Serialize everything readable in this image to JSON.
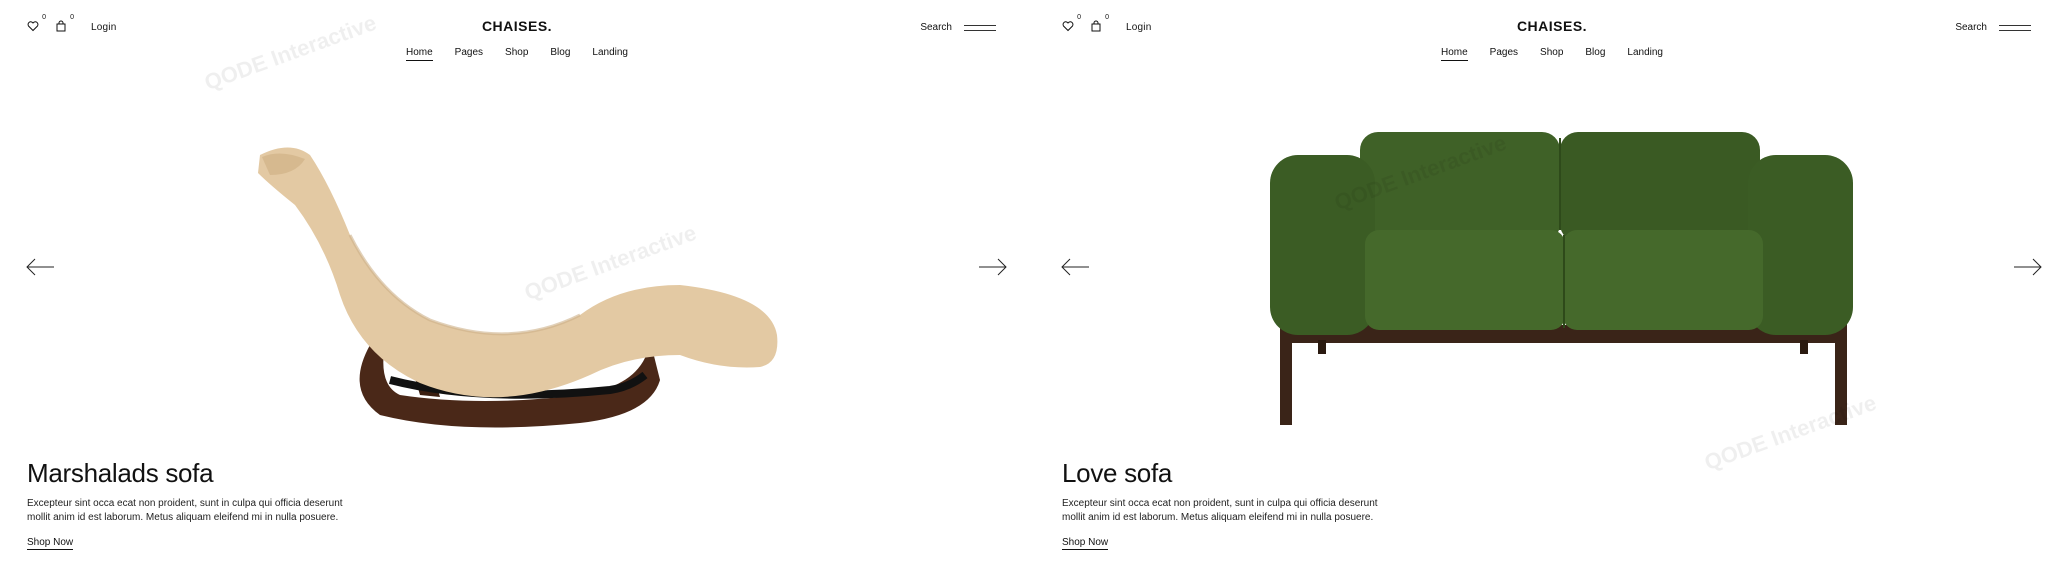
{
  "slides": [
    {
      "header": {
        "wishlist_count": "0",
        "cart_count": "0",
        "login_label": "Login",
        "logo": "CHAISES.",
        "nav": [
          "Home",
          "Pages",
          "Shop",
          "Blog",
          "Landing"
        ],
        "search_label": "Search"
      },
      "product": {
        "title": "Marshalads sofa",
        "description": "Excepteur sint occa ecat non proident, sunt in culpa qui officia deserunt mollit anim id est laborum. Metus aliquam eleifend mi in nulla posuere.",
        "cta": "Shop Now",
        "colors": {
          "fabric": "#e3c9a3",
          "wood": "#4a2818"
        }
      }
    },
    {
      "header": {
        "wishlist_count": "0",
        "cart_count": "0",
        "login_label": "Login",
        "logo": "CHAISES.",
        "nav": [
          "Home",
          "Pages",
          "Shop",
          "Blog",
          "Landing"
        ],
        "search_label": "Search"
      },
      "product": {
        "title": "Love sofa",
        "description": "Excepteur sint occa ecat non proident, sunt in culpa qui officia deserunt mollit anim id est laborum. Metus aliquam eleifend mi in nulla posuere.",
        "cta": "Shop Now",
        "colors": {
          "fabric": "#3f6127",
          "wood": "#3a2418"
        }
      }
    }
  ],
  "icons": [
    "heart-icon",
    "cart-icon",
    "hamburger-icon",
    "arrow-left-icon",
    "arrow-right-icon"
  ],
  "watermark": "QODE Interactive"
}
